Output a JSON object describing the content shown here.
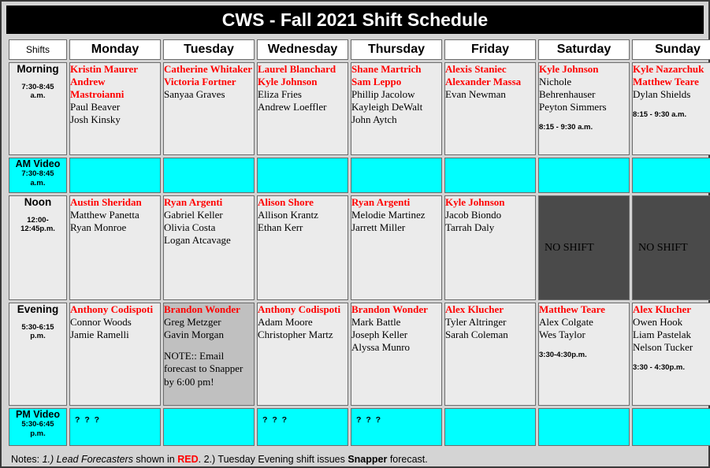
{
  "title": "CWS - Fall 2021 Shift Schedule",
  "header": {
    "shifts_label": "Shifts",
    "days": [
      "Monday",
      "Tuesday",
      "Wednesday",
      "Thursday",
      "Friday",
      "Saturday",
      "Sunday"
    ]
  },
  "colors": {
    "title_bar_bg": "#000000",
    "title_text": "#ffffff",
    "lead_forecaster_red": "#ff0000",
    "label_gray": "#c0c0c0",
    "cell_light": "#ebebeb",
    "video_cyan": "#00ffff",
    "noshift_dark": "#4a4a4a",
    "page_bg": "#d4d4d4"
  },
  "rows": [
    {
      "label": "Morning",
      "time": "7:30-8:45 a.m.",
      "time_line1": "7:30-8:45",
      "time_line2": "a.m.",
      "cells": [
        {
          "leads": [
            "Kristin Maurer",
            "Andrew Mastroianni"
          ],
          "staff": [
            "Paul Beaver",
            "Josh Kinsky"
          ],
          "timenote": ""
        },
        {
          "leads": [
            "Catherine Whitaker",
            "Victoria Fortner"
          ],
          "staff": [
            "Sanyaa Graves"
          ],
          "timenote": ""
        },
        {
          "leads": [
            "Laurel Blanchard",
            "Kyle Johnson"
          ],
          "staff": [
            "Eliza Fries",
            "Andrew Loeffler"
          ],
          "timenote": ""
        },
        {
          "leads": [
            "Shane Martrich",
            "Sam Leppo"
          ],
          "staff": [
            "Phillip Jacolow",
            "Kayleigh DeWalt",
            "John Aytch"
          ],
          "timenote": ""
        },
        {
          "leads": [
            "Alexis Staniec",
            "Alexander Massa"
          ],
          "staff": [
            "Evan Newman"
          ],
          "timenote": ""
        },
        {
          "leads": [
            "Kyle Johnson"
          ],
          "staff": [
            "Nichole Behrenhauser",
            "Peyton Simmers"
          ],
          "timenote": "8:15 - 9:30 a.m."
        },
        {
          "leads": [
            "Kyle Nazarchuk",
            "Matthew Teare"
          ],
          "staff": [
            "Dylan Shields"
          ],
          "timenote": "8:15 - 9:30 a.m."
        }
      ]
    },
    {
      "label": "AM Video",
      "time": "7:30-8:45 a.m.",
      "time_line1": "7:30-8:45",
      "time_line2": "a.m.",
      "cells": [
        {
          "leads": [],
          "staff": [],
          "timenote": ""
        },
        {
          "leads": [],
          "staff": [],
          "timenote": ""
        },
        {
          "leads": [],
          "staff": [],
          "timenote": ""
        },
        {
          "leads": [],
          "staff": [],
          "timenote": ""
        },
        {
          "leads": [],
          "staff": [],
          "timenote": ""
        },
        {
          "leads": [],
          "staff": [],
          "timenote": ""
        },
        {
          "leads": [],
          "staff": [],
          "timenote": ""
        }
      ]
    },
    {
      "label": "Noon",
      "time": "12:00-12:45p.m.",
      "time_line1": "12:00-",
      "time_line2": "12:45p.m.",
      "cells": [
        {
          "leads": [
            "Austin Sheridan"
          ],
          "staff": [
            "Matthew Panetta",
            "Ryan Monroe"
          ],
          "timenote": ""
        },
        {
          "leads": [
            "Ryan Argenti"
          ],
          "staff": [
            "Gabriel Keller",
            "Olivia Costa",
            "Logan Atcavage"
          ],
          "timenote": ""
        },
        {
          "leads": [
            "Alison Shore"
          ],
          "staff": [
            "Allison Krantz",
            "Ethan Kerr"
          ],
          "timenote": ""
        },
        {
          "leads": [
            "Ryan Argenti"
          ],
          "staff": [
            "Melodie Martinez",
            "Jarrett Miller"
          ],
          "timenote": ""
        },
        {
          "leads": [
            "Kyle Johnson"
          ],
          "staff": [
            "Jacob Biondo",
            "Tarrah Daly"
          ],
          "timenote": ""
        },
        {
          "leads": [],
          "staff": [],
          "timenote": "",
          "noshift": "NO SHIFT"
        },
        {
          "leads": [],
          "staff": [],
          "timenote": "",
          "noshift": "NO SHIFT"
        }
      ]
    },
    {
      "label": "Evening",
      "time": "5:30-6:15 p.m.",
      "time_line1": "5:30-6:15",
      "time_line2": "p.m.",
      "cells": [
        {
          "leads": [
            "Anthony Codispoti"
          ],
          "staff": [
            "Connor Woods",
            "Jamie Ramelli"
          ],
          "timenote": ""
        },
        {
          "leads": [
            "Brandon Wonder"
          ],
          "staff": [
            "Greg Metzger",
            "Gavin Morgan"
          ],
          "note": "NOTE:: Email forecast to Snapper by 6:00 pm!",
          "timenote": ""
        },
        {
          "leads": [
            "Anthony Codispoti"
          ],
          "staff": [
            "Adam Moore",
            "Christopher Martz"
          ],
          "timenote": ""
        },
        {
          "leads": [
            "Brandon Wonder"
          ],
          "staff": [
            "Mark Battle",
            "Joseph Keller",
            "Alyssa Munro"
          ],
          "timenote": ""
        },
        {
          "leads": [
            "Alex Klucher"
          ],
          "staff": [
            "Tyler Altringer",
            "Sarah Coleman"
          ],
          "timenote": ""
        },
        {
          "leads": [
            "Matthew Teare"
          ],
          "staff": [
            "Alex Colgate",
            "Wes Taylor"
          ],
          "timenote": "3:30-4:30p.m."
        },
        {
          "leads": [
            "Alex Klucher"
          ],
          "staff": [
            "Owen Hook",
            "Liam Pastelak",
            "Nelson Tucker"
          ],
          "timenote": "3:30 - 4:30p.m."
        }
      ]
    },
    {
      "label": "PM Video",
      "time": "5:30-6:45 p.m.",
      "time_line1": "5:30-6:45",
      "time_line2": "p.m.",
      "cells": [
        {
          "leads": [],
          "staff": [],
          "timenote": "",
          "qmarks": "? ? ?"
        },
        {
          "leads": [],
          "staff": [],
          "timenote": ""
        },
        {
          "leads": [],
          "staff": [],
          "timenote": "",
          "qmarks": "? ? ?"
        },
        {
          "leads": [],
          "staff": [],
          "timenote": "",
          "qmarks": "? ? ?"
        },
        {
          "leads": [],
          "staff": [],
          "timenote": ""
        },
        {
          "leads": [],
          "staff": [],
          "timenote": ""
        },
        {
          "leads": [],
          "staff": [],
          "timenote": ""
        }
      ]
    }
  ],
  "footer": {
    "prefix": "Notes: ",
    "italic_part": "1.) Lead Forecasters",
    "mid1": " shown in ",
    "red_word": "RED",
    "mid2": ". 2.) Tuesday Evening shift issues ",
    "bold_word": "Snapper",
    "suffix": " forecast."
  }
}
